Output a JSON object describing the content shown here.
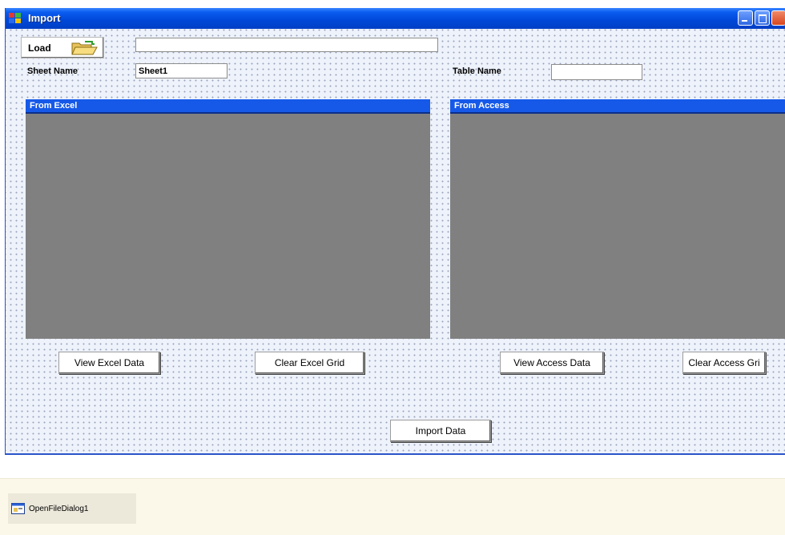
{
  "window": {
    "title": "Import",
    "colors": {
      "titlebar": "#0047d8",
      "grid_bg": "#808080",
      "grid_header": "#1659e8"
    }
  },
  "load_button": {
    "label": "Load",
    "icon": "folder-open-icon"
  },
  "file_path": {
    "value": ""
  },
  "sheet_name": {
    "label": "Sheet Name",
    "value": "Sheet1"
  },
  "table_name": {
    "label": "Table Name",
    "value": ""
  },
  "excel_grid": {
    "caption": "From Excel"
  },
  "access_grid": {
    "caption": "From Access"
  },
  "buttons": {
    "view_excel": "View Excel Data",
    "clear_excel": "Clear Excel Grid",
    "view_access": "View Access Data",
    "clear_access": "Clear Access Gri",
    "import": "Import Data"
  },
  "component_tray": {
    "items": [
      {
        "label": "OpenFileDialog1",
        "icon": "dialog-icon"
      }
    ]
  }
}
